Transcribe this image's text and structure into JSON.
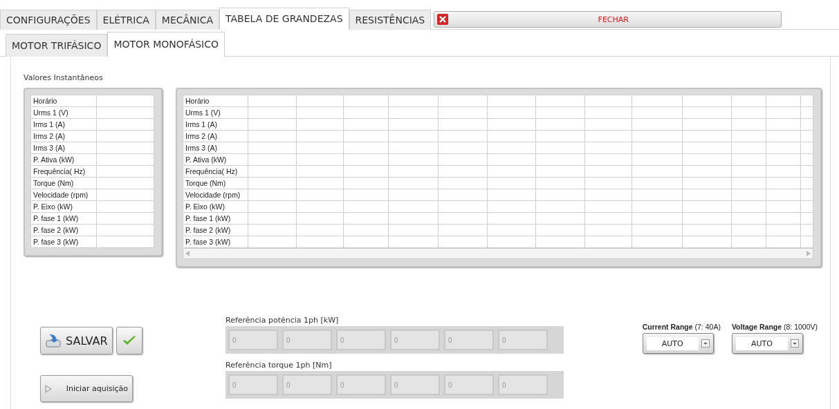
{
  "tabs": [
    {
      "label": "CONFIGURAÇÕES",
      "selected": false
    },
    {
      "label": "ELÉTRICA",
      "selected": false
    },
    {
      "label": "MECÂNICA",
      "selected": false
    },
    {
      "label": "TABELA DE GRANDEZAS",
      "selected": true
    },
    {
      "label": "RESISTÊNCIAS",
      "selected": false
    }
  ],
  "close_button": {
    "label": "FECHAR"
  },
  "subtabs": [
    {
      "label": "MOTOR TRIFÁSICO",
      "selected": false
    },
    {
      "label": "MOTOR MONOFÁSICO",
      "selected": true
    }
  ],
  "instant_values": {
    "title": "Valores Instantâneos",
    "rows": [
      "Horário",
      "Urms 1 (V)",
      "Irms 1 (A)",
      "Irms 2 (A)",
      "Irms 3 (A)",
      "P. Ativa (kW)",
      "Frequência( Hz)",
      "Torque (Nm)",
      "Velocidade (rpm)",
      "P. Eixo (kW)",
      "P. fase 1 (kW)",
      "P. fase 2 (kW)",
      "P. fase 3 (kW)"
    ]
  },
  "history_table": {
    "rows": [
      "Horário",
      "Urms 1 (V)",
      "Irms 1 (A)",
      "Irms 2 (A)",
      "Irms 3 (A)",
      "P. Ativa (kW)",
      "Frequência( Hz)",
      "Torque (Nm)",
      "Velocidade (rpm)",
      "P. Eixo (kW)",
      "P. fase 1 (kW)",
      "P. fase 2 (kW)",
      "P. fase 3 (kW)"
    ]
  },
  "save_button": {
    "label": "SALVAR"
  },
  "start_button": {
    "label": "Iniciar aquisição"
  },
  "references": [
    {
      "label": "Referência potência 1ph [kW]",
      "values": [
        "0",
        "0",
        "0",
        "0",
        "0",
        "0"
      ]
    },
    {
      "label": "Referência torque 1ph [Nm]",
      "values": [
        "0",
        "0",
        "0",
        "0",
        "0",
        "0"
      ]
    }
  ],
  "ranges": [
    {
      "label": "Current Range",
      "detail": "(7: 40A)",
      "value": "AUTO"
    },
    {
      "label": "Voltage Range",
      "detail": "(8: 1000V)",
      "value": "AUTO"
    }
  ]
}
